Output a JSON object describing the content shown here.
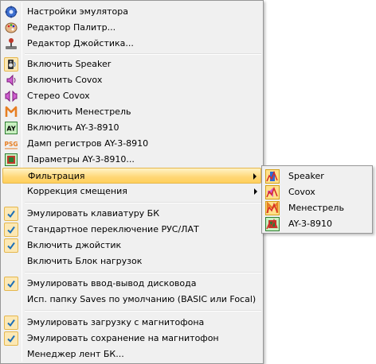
{
  "menu": {
    "items": [
      {
        "label": "Настройки эмулятора",
        "icon": "gear-icon"
      },
      {
        "label": "Редактор Палитр...",
        "icon": "palette-icon"
      },
      {
        "label": "Редактор Джойстика...",
        "icon": "joystick-icon"
      },
      {
        "label": "Включить Speaker",
        "icon": "speaker-icon",
        "checked": true
      },
      {
        "label": "Включить Covox",
        "icon": "covox-icon"
      },
      {
        "label": "Стерео Covox",
        "icon": "stereo-covox-icon"
      },
      {
        "label": "Включить Менестрель",
        "icon": "menestrel-icon"
      },
      {
        "label": "Включить AY-3-8910",
        "icon": "ay-chip-icon"
      },
      {
        "label": "Дамп регистров AY-3-8910",
        "icon": "psg-dump-icon"
      },
      {
        "label": "Параметры AY-3-8910...",
        "icon": "ay-params-icon"
      },
      {
        "label": "Фильтрация",
        "has_submenu": true,
        "highlighted": true
      },
      {
        "label": "Коррекция смещения",
        "has_submenu": true
      },
      {
        "label": "Эмулировать клавиатуру БК",
        "checked": true
      },
      {
        "label": "Стандартное переключение РУС/ЛАТ",
        "checked": true
      },
      {
        "label": "Включить джойстик",
        "checked": true
      },
      {
        "label": "Включить Блок нагрузок"
      },
      {
        "label": "Эмулировать ввод-вывод дисковода",
        "checked": true
      },
      {
        "label": "Исп. папку Saves по умолчанию (BASIC или Focal)"
      },
      {
        "label": "Эмулировать загрузку с магнитофона",
        "checked": true
      },
      {
        "label": "Эмулировать сохранение на магнитофон",
        "checked": true
      },
      {
        "label": "Менеджер лент БК..."
      }
    ]
  },
  "submenu": {
    "items": [
      {
        "label": "Speaker",
        "icon": "filter-speaker-icon"
      },
      {
        "label": "Covox",
        "icon": "filter-covox-icon"
      },
      {
        "label": "Менестрель",
        "icon": "filter-menestrel-icon"
      },
      {
        "label": "AY-3-8910",
        "icon": "filter-ay-icon"
      }
    ]
  },
  "icons": {
    "ay_text": "AY",
    "psg_text": "PSG"
  },
  "colors": {
    "highlight": "#ffd776",
    "check": "#1d6fb8",
    "menu_bg": "#f0f0f0"
  }
}
